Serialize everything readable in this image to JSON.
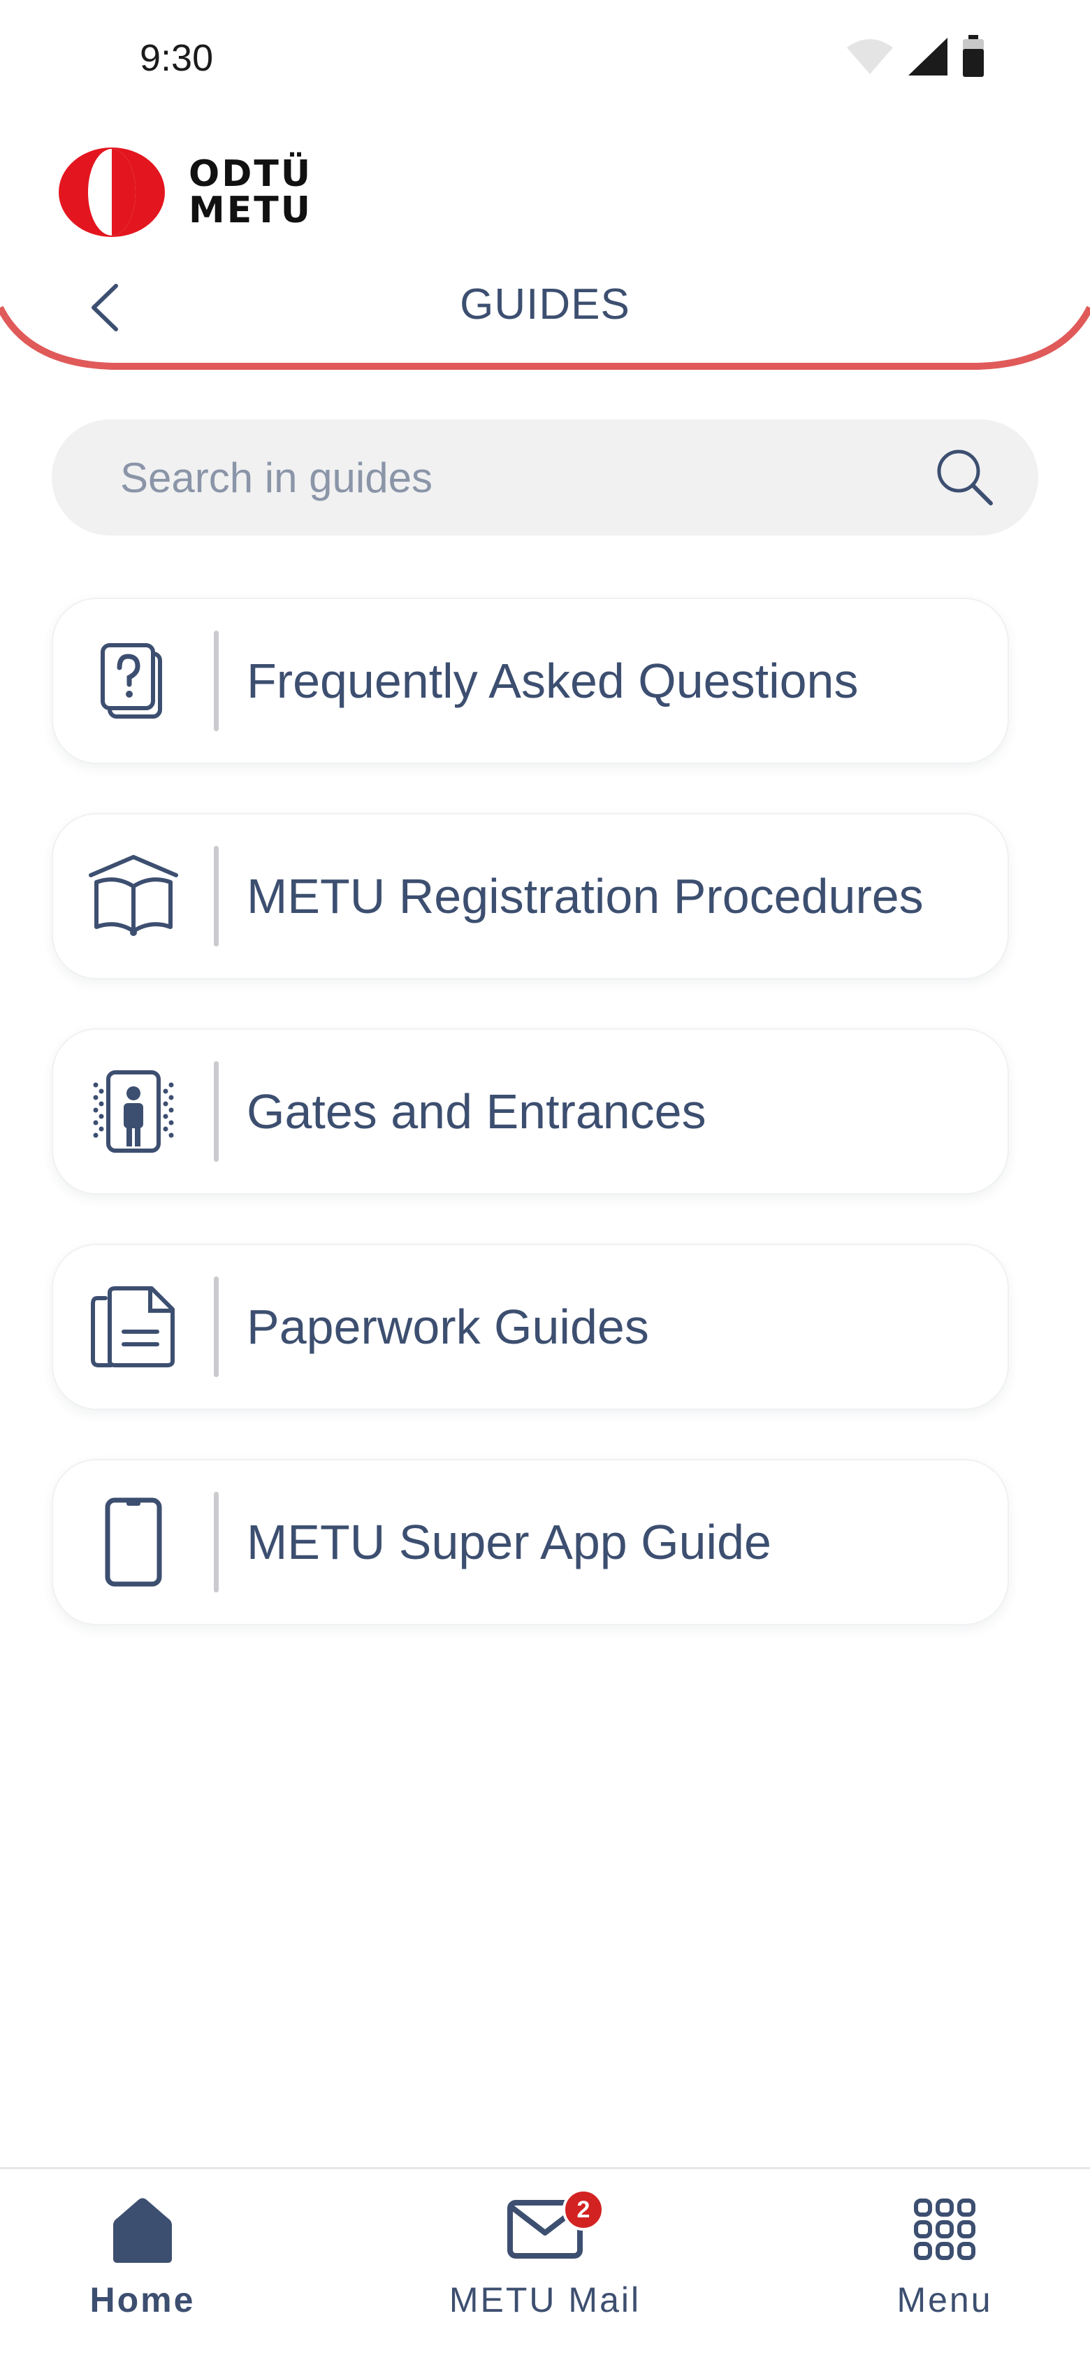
{
  "status_bar": {
    "time": "9:30"
  },
  "brand": {
    "line1": "ODTÜ",
    "line2": "METU"
  },
  "header": {
    "title": "GUIDES"
  },
  "search": {
    "placeholder": "Search in guides",
    "value": ""
  },
  "guides": [
    {
      "label": "Frequently Asked Questions",
      "icon": "faq-icon"
    },
    {
      "label": "METU Registration Procedures",
      "icon": "open-book-icon"
    },
    {
      "label": "Gates and Entrances",
      "icon": "gate-person-icon"
    },
    {
      "label": "Paperwork Guides",
      "icon": "documents-icon"
    },
    {
      "label": "METU Super App Guide",
      "icon": "smartphone-icon"
    }
  ],
  "bottom_nav": {
    "home": "Home",
    "mail": "METU Mail",
    "mail_badge": "2",
    "menu": "Menu"
  },
  "colors": {
    "accent_red": "#e3161f",
    "header_curve": "#e05a5a",
    "text": "#3d4f70",
    "badge": "#d32222"
  }
}
